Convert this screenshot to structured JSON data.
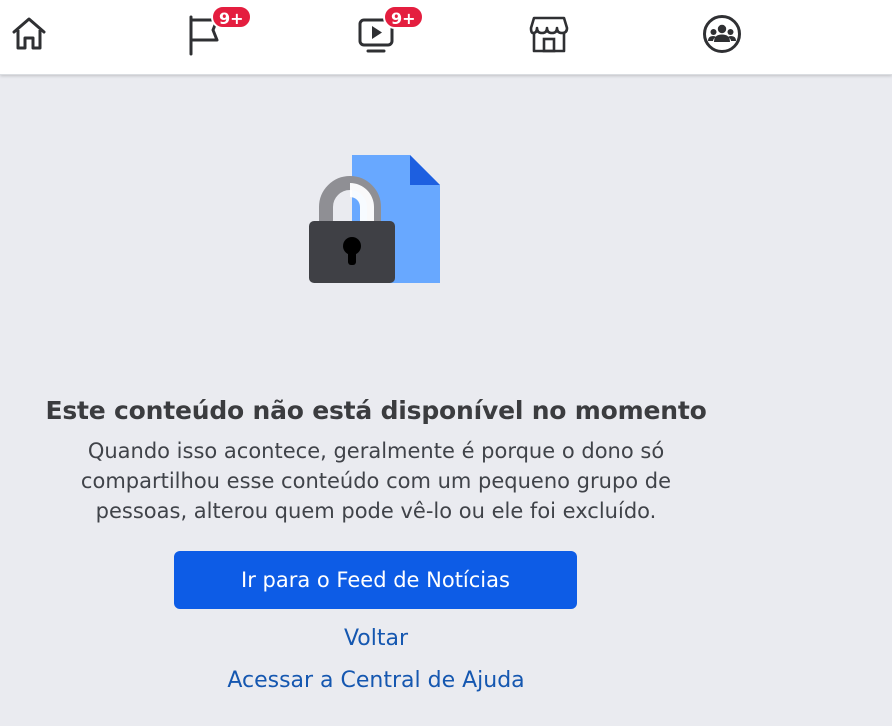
{
  "nav": {
    "tabs": [
      {
        "name": "home",
        "icon": "home-icon",
        "badge": ""
      },
      {
        "name": "pages",
        "icon": "flag-icon",
        "badge": "9+"
      },
      {
        "name": "video",
        "icon": "video-play-icon",
        "badge": "9+"
      },
      {
        "name": "marketplace",
        "icon": "store-icon",
        "badge": ""
      },
      {
        "name": "groups",
        "icon": "groups-icon",
        "badge": ""
      }
    ]
  },
  "error": {
    "title": "Este conteúdo não está disponível no momento",
    "description_lines": [
      "Quando isso acontece, geralmente é porque o dono só",
      "compartilhou esse conteúdo com um pequeno grupo de",
      "pessoas, alterou quem pode vê-lo ou ele foi excluído."
    ],
    "primary_button": "Ir para o Feed de Notícias",
    "back_link": "Voltar",
    "help_link": "Acessar a Central de Ajuda"
  },
  "colors": {
    "background": "#eaebf0",
    "topbar": "#ffffff",
    "badge": "#e41e3f",
    "primary_button": "#0d5ce6",
    "link": "#1557b0",
    "document": "#68a8ff",
    "document_fold": "#1d5fe0",
    "lock_body": "#3f4045",
    "lock_shackle": "#8f8f94"
  }
}
